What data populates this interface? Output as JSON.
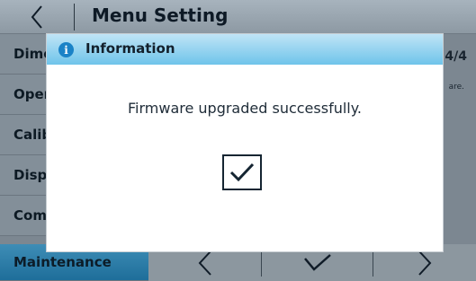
{
  "header": {
    "title": "Menu Setting"
  },
  "sidebar": {
    "items": [
      {
        "label": "Dimensions"
      },
      {
        "label": "Operation"
      },
      {
        "label": "Calibration"
      },
      {
        "label": "Display"
      },
      {
        "label": "Communication"
      },
      {
        "label": "Maintenance"
      }
    ],
    "active_index": 5
  },
  "panel": {
    "page_indicator": "4/4",
    "description_fragment": "are."
  },
  "footer": {
    "buttons": [
      "previous",
      "confirm",
      "next"
    ]
  },
  "dialog": {
    "title": "Information",
    "message": "Firmware upgraded successfully.",
    "icon": "info-icon",
    "ok_icon": "checkmark-icon"
  },
  "colors": {
    "accent": "#1a82c7",
    "dialog_header": "#8fd2f0",
    "active_item": "#2a7fae"
  }
}
